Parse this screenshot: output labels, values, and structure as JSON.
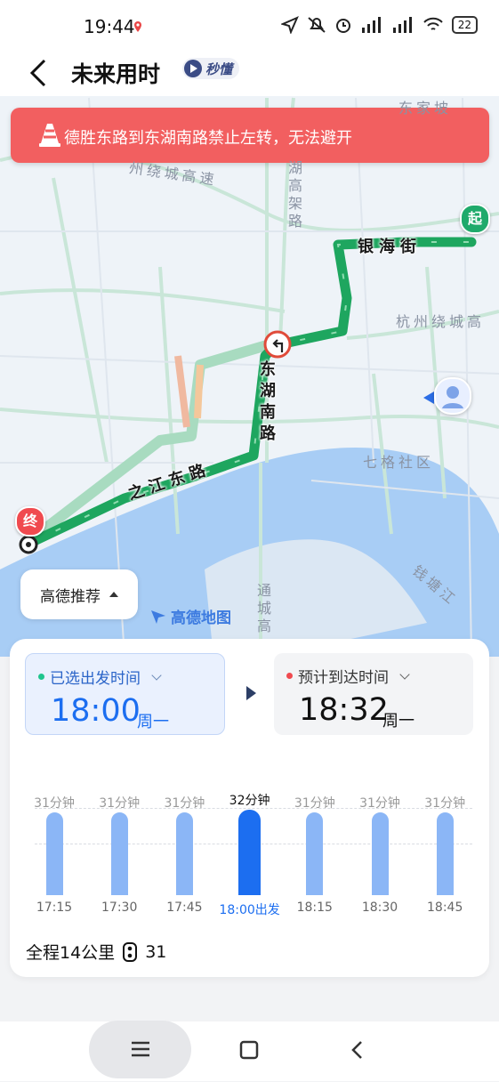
{
  "status_bar": {
    "time": "19:44",
    "battery": "22"
  },
  "title_bar": {
    "title": "未来用时",
    "badge": "秒懂"
  },
  "alert": {
    "message": "德胜东路到东湖南路禁止左转，无法避开"
  },
  "map": {
    "labels": {
      "expressway": "州绕城高速",
      "dhg_elevated": "湖高架路",
      "yinhai": "银海街",
      "ring_east": "杭州绕城高",
      "donghu_south": "东湖南路",
      "zhijiang": "之江东路",
      "qige": "七格社区",
      "qiantang": "钱塘江",
      "tongcheng": "通城高",
      "top_partial": "东家坡"
    },
    "start_marker": "起",
    "end_marker": "终",
    "recommend_label": "高德推荐",
    "logo_text": "高德地图"
  },
  "depart": {
    "label": "已选出发时间",
    "time": "18:00",
    "weekday": "周一"
  },
  "arrive": {
    "label": "预计到达时间",
    "time": "18:32",
    "weekday": "周一"
  },
  "chart_data": {
    "type": "bar",
    "categories": [
      "17:15",
      "17:30",
      "17:45",
      "18:00出发",
      "18:15",
      "18:30",
      "18:45"
    ],
    "values": [
      31,
      31,
      31,
      32,
      31,
      31,
      31
    ],
    "value_labels": [
      "31分钟",
      "31分钟",
      "31分钟",
      "32分钟",
      "31分钟",
      "31分钟",
      "31分钟"
    ],
    "unit": "分钟",
    "selected_index": 3,
    "colors": {
      "normal": "#8bb6f6",
      "selected": "#1c6ef0"
    }
  },
  "summary": {
    "distance": "全程14公里",
    "lights": "31"
  },
  "colors": {
    "accent": "#1c6ef0",
    "route": "#1ea65f",
    "alert": "#f25f60"
  }
}
